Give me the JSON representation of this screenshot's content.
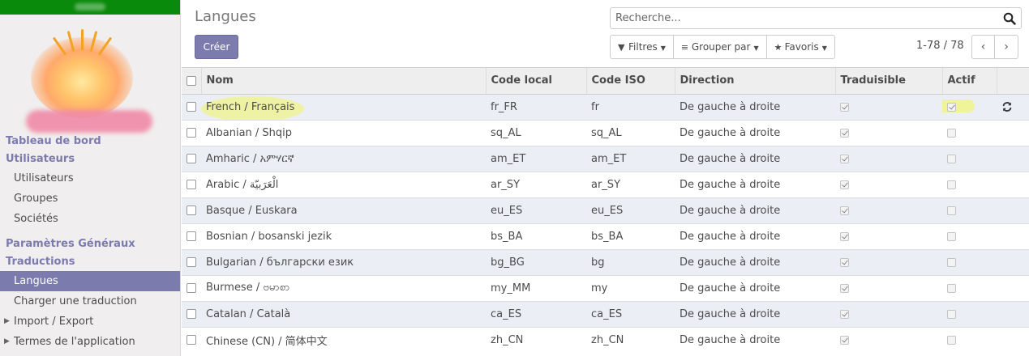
{
  "sidebar": {
    "sections": [
      {
        "items": [
          {
            "label": "Tableau de bord",
            "type": "head"
          },
          {
            "label": "Utilisateurs",
            "type": "head"
          },
          {
            "label": "Utilisateurs",
            "type": "item"
          },
          {
            "label": "Groupes",
            "type": "item"
          },
          {
            "label": "Sociétés",
            "type": "item"
          }
        ]
      },
      {
        "items": [
          {
            "label": "Paramètres Généraux",
            "type": "head"
          },
          {
            "label": "Traductions",
            "type": "head"
          },
          {
            "label": "Langues",
            "type": "item",
            "active": true
          },
          {
            "label": "Charger une traduction",
            "type": "item"
          },
          {
            "label": "Import / Export",
            "type": "item",
            "caret": true
          },
          {
            "label": "Termes de l'application",
            "type": "item",
            "caret": true
          }
        ]
      }
    ]
  },
  "control": {
    "title": "Langues",
    "create_label": "Créer",
    "search_placeholder": "Recherche...",
    "filters_label": "Filtres",
    "groupby_label": "Grouper par",
    "favorites_label": "Favoris",
    "pager": "1-78 / 78"
  },
  "table": {
    "columns": [
      "Nom",
      "Code local",
      "Code ISO",
      "Direction",
      "Traduisible",
      "Actif"
    ],
    "rows": [
      {
        "name": "French / Français",
        "code": "fr_FR",
        "iso": "fr",
        "direction": "De gauche à droite",
        "translatable": true,
        "active": true,
        "reload": true
      },
      {
        "name": "Albanian / Shqip",
        "code": "sq_AL",
        "iso": "sq_AL",
        "direction": "De gauche à droite",
        "translatable": true,
        "active": false
      },
      {
        "name": "Amharic / አምሃርኛ",
        "code": "am_ET",
        "iso": "am_ET",
        "direction": "De gauche à droite",
        "translatable": true,
        "active": false
      },
      {
        "name": "Arabic / الْعَرَبيّة",
        "code": "ar_SY",
        "iso": "ar_SY",
        "direction": "De gauche à droite",
        "translatable": true,
        "active": false
      },
      {
        "name": "Basque / Euskara",
        "code": "eu_ES",
        "iso": "eu_ES",
        "direction": "De gauche à droite",
        "translatable": true,
        "active": false
      },
      {
        "name": "Bosnian / bosanski jezik",
        "code": "bs_BA",
        "iso": "bs_BA",
        "direction": "De gauche à droite",
        "translatable": true,
        "active": false
      },
      {
        "name": "Bulgarian / български език",
        "code": "bg_BG",
        "iso": "bg",
        "direction": "De gauche à droite",
        "translatable": true,
        "active": false
      },
      {
        "name": "Burmese / ဗမာစာ",
        "code": "my_MM",
        "iso": "my",
        "direction": "De gauche à droite",
        "translatable": true,
        "active": false
      },
      {
        "name": "Catalan / Català",
        "code": "ca_ES",
        "iso": "ca_ES",
        "direction": "De gauche à droite",
        "translatable": true,
        "active": false
      },
      {
        "name": "Chinese (CN) / 简体中文",
        "code": "zh_CN",
        "iso": "zh_CN",
        "direction": "De gauche à droite",
        "translatable": true,
        "active": false
      }
    ]
  },
  "colors": {
    "brand": "#7c7bad",
    "topbar": "#0a8a0a",
    "highlight": "#f0f578"
  }
}
